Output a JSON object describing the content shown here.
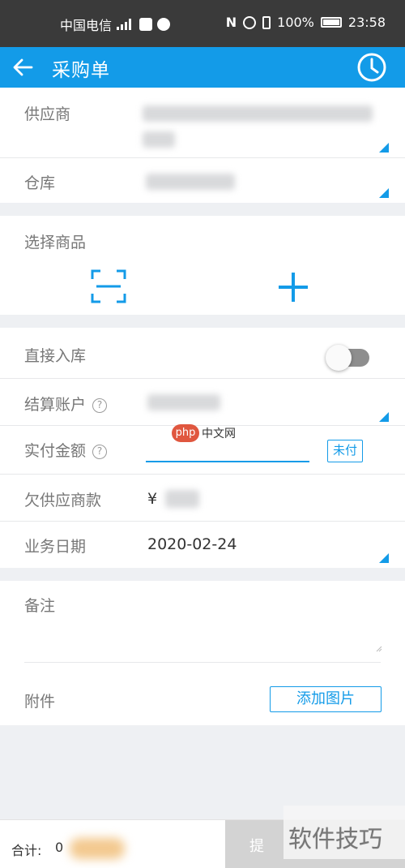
{
  "status_bar": {
    "carrier": "中国电信",
    "battery": "100%",
    "time": "23:58"
  },
  "app_bar": {
    "title": "采购单"
  },
  "supplier_section": {
    "supplier_label": "供应商",
    "warehouse_label": "仓库"
  },
  "goods_section": {
    "title": "选择商品"
  },
  "settle_section": {
    "direct_stock_label": "直接入库",
    "direct_stock_on": false,
    "account_label": "结算账户",
    "paid_label": "实付金额",
    "unpaid_button": "未付",
    "owed_label": "欠供应商款",
    "owed_value": "¥",
    "date_label": "业务日期",
    "date_value": "2020-02-24",
    "help_glyph": "?"
  },
  "notes_section": {
    "remark_label": "备注",
    "attachment_label": "附件",
    "add_image_button": "添加图片"
  },
  "footer": {
    "total_label": "合计:",
    "total_value": "0",
    "submit_label": "提",
    "watermark": "软件技巧"
  },
  "overlay": {
    "logo_text": "php",
    "logo_suffix": "中文网"
  },
  "colors": {
    "accent": "#139be8",
    "status_bar": "#3a3a3a"
  }
}
